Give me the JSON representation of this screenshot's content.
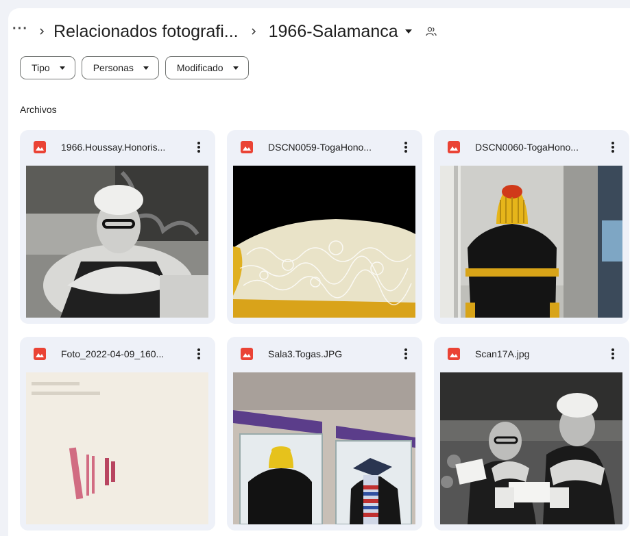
{
  "breadcrumb": {
    "more_label": "···",
    "parent": "Relacionados fotografi...",
    "current": "1966-Salamanca"
  },
  "filters": [
    {
      "label": "Tipo"
    },
    {
      "label": "Personas"
    },
    {
      "label": "Modificado"
    }
  ],
  "section_label": "Archivos",
  "files": [
    {
      "name": "1966.Houssay.Honoris...",
      "icon": "image-file-icon"
    },
    {
      "name": "DSCN0059-TogaHono...",
      "icon": "image-file-icon"
    },
    {
      "name": "DSCN0060-TogaHono...",
      "icon": "image-file-icon"
    },
    {
      "name": "Foto_2022-04-09_160...",
      "icon": "image-file-icon"
    },
    {
      "name": "Sala3.Togas.JPG",
      "icon": "image-file-icon"
    },
    {
      "name": "Scan17A.jpg",
      "icon": "image-file-icon"
    }
  ],
  "colors": {
    "image_icon": "#ea4335",
    "card_bg": "#eef1f8",
    "toga_yellow": "#e8b81a"
  }
}
